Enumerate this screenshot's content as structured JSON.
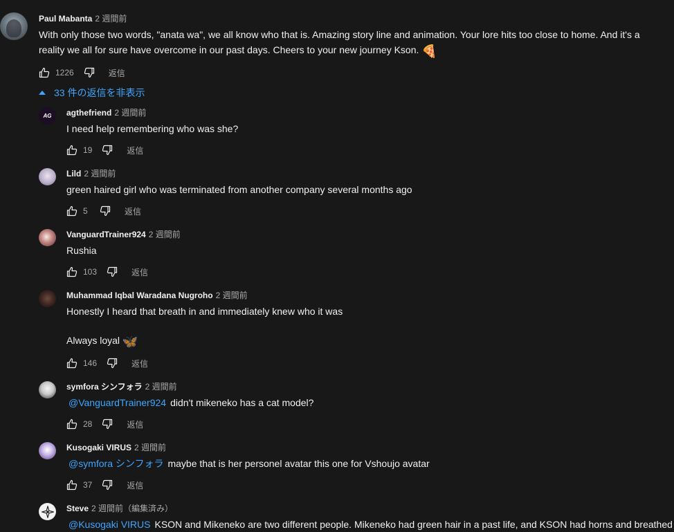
{
  "top_comment": {
    "author": "Paul Mabanta",
    "time": "2 週間前",
    "lines": [
      "With only those two words, \"anata wa\", we all know who that is. Amazing story line and animation. Your lore hits too close to home. And it's a",
      "reality we all for sure have overcome in our past days.  Cheers to your new journey Kson."
    ],
    "emoji": "🍕",
    "likes": "1226",
    "reply_label": "返信"
  },
  "replies_toggle": {
    "label": "33 件の返信を非表示"
  },
  "replies": [
    {
      "author": "agthefriend",
      "time": "2 週間前",
      "mention": "",
      "text": "I need help remembering who was she?",
      "likes": "19",
      "reply_label": "返信"
    },
    {
      "author": "Lild",
      "time": "2 週間前",
      "mention": "",
      "text": "green haired girl who was terminated from another company several months ago",
      "likes": "5",
      "reply_label": "返信"
    },
    {
      "author": "VanguardTrainer924",
      "time": "2 週間前",
      "mention": "",
      "text": "Rushia",
      "likes": "103",
      "reply_label": "返信"
    },
    {
      "author": "Muhammad Iqbal Waradana Nugroho",
      "time": "2 週間前",
      "mention": "",
      "text": "Honestly I heard that breath in and immediately knew who it was",
      "text2": "Always loyal",
      "emoji": "🦋",
      "likes": "146",
      "reply_label": "返信"
    },
    {
      "author": "symfora シンフォラ",
      "time": "2 週間前",
      "mention": "@VanguardTrainer924",
      "text": "didn't mikeneko has a cat model?",
      "likes": "28",
      "reply_label": "返信"
    },
    {
      "author": "Kusogaki VIRUS",
      "time": "2 週間前",
      "mention": "@symfora シンフォラ",
      "text": "maybe that is her personel avatar this one for Vshoujo avatar",
      "likes": "37",
      "reply_label": "返信"
    },
    {
      "author": "Steve",
      "time": "2 週間前（編集済み）",
      "mention": "@Kusogaki VIRUS",
      "text": "KSON and Mikeneko are two different people. Mikeneko had green hair in a past life, and KSON had horns and breathed"
    }
  ],
  "avatar_badge": "AG",
  "colors": {
    "background": "#181818",
    "text": "#f1f1f1",
    "muted": "#aaaaaa",
    "link": "#3ea6ff"
  }
}
